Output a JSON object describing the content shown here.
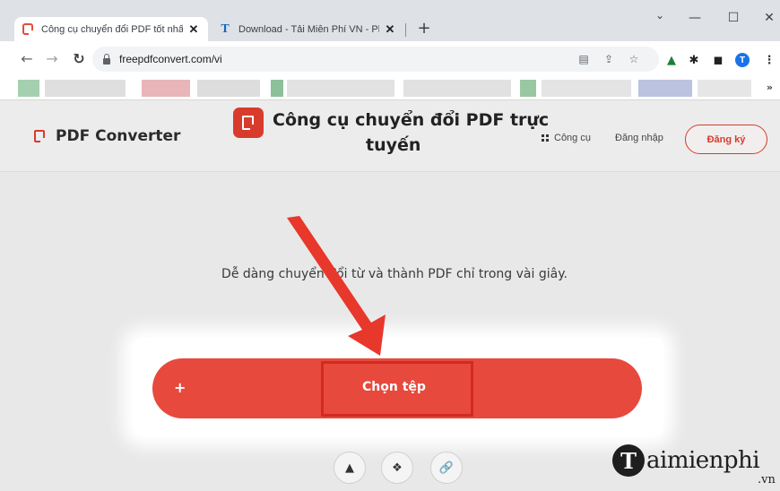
{
  "browser": {
    "tabs": [
      {
        "title": "Công cụ chuyển đổi PDF tốt nhất",
        "active": true,
        "icon": "pdf-converter-favicon"
      },
      {
        "title": "Download - Tải Miễn Phí VN - Ph",
        "active": false,
        "icon": "taimienphi-favicon"
      }
    ],
    "new_tab": "+",
    "window_controls": {
      "dropdown": "⌄",
      "minimize": "—",
      "maximize": "☐",
      "close": "✕"
    },
    "url": "freepdfconvert.com/vi",
    "nav": {
      "back": "←",
      "forward": "→",
      "reload": "↻"
    },
    "profile_initial": "T",
    "bookmarks_more": "»"
  },
  "site": {
    "brand": "PDF Converter",
    "hero_title_line1": "Công cụ chuyển đổi PDF trực",
    "hero_title_line2": "tuyến",
    "nav_tools": "Công cụ",
    "nav_login": "Đăng nhập",
    "nav_signup": "Đăng ký",
    "subtitle": "Dễ dàng chuyển đổi từ và thành PDF chỉ trong vài giây.",
    "upload": {
      "plus": "+",
      "label": "Chọn tệp"
    },
    "sources": [
      {
        "icon": "google-drive-icon",
        "glyph": "▲"
      },
      {
        "icon": "dropbox-icon",
        "glyph": "❖"
      },
      {
        "icon": "link-icon",
        "glyph": "🔗"
      }
    ]
  },
  "watermark": {
    "initial": "T",
    "text": "aimienphi",
    "suffix": ".vn"
  },
  "colors": {
    "accent": "#e8493d",
    "highlight": "#d42a1e",
    "chrome": "#dee1e6"
  }
}
